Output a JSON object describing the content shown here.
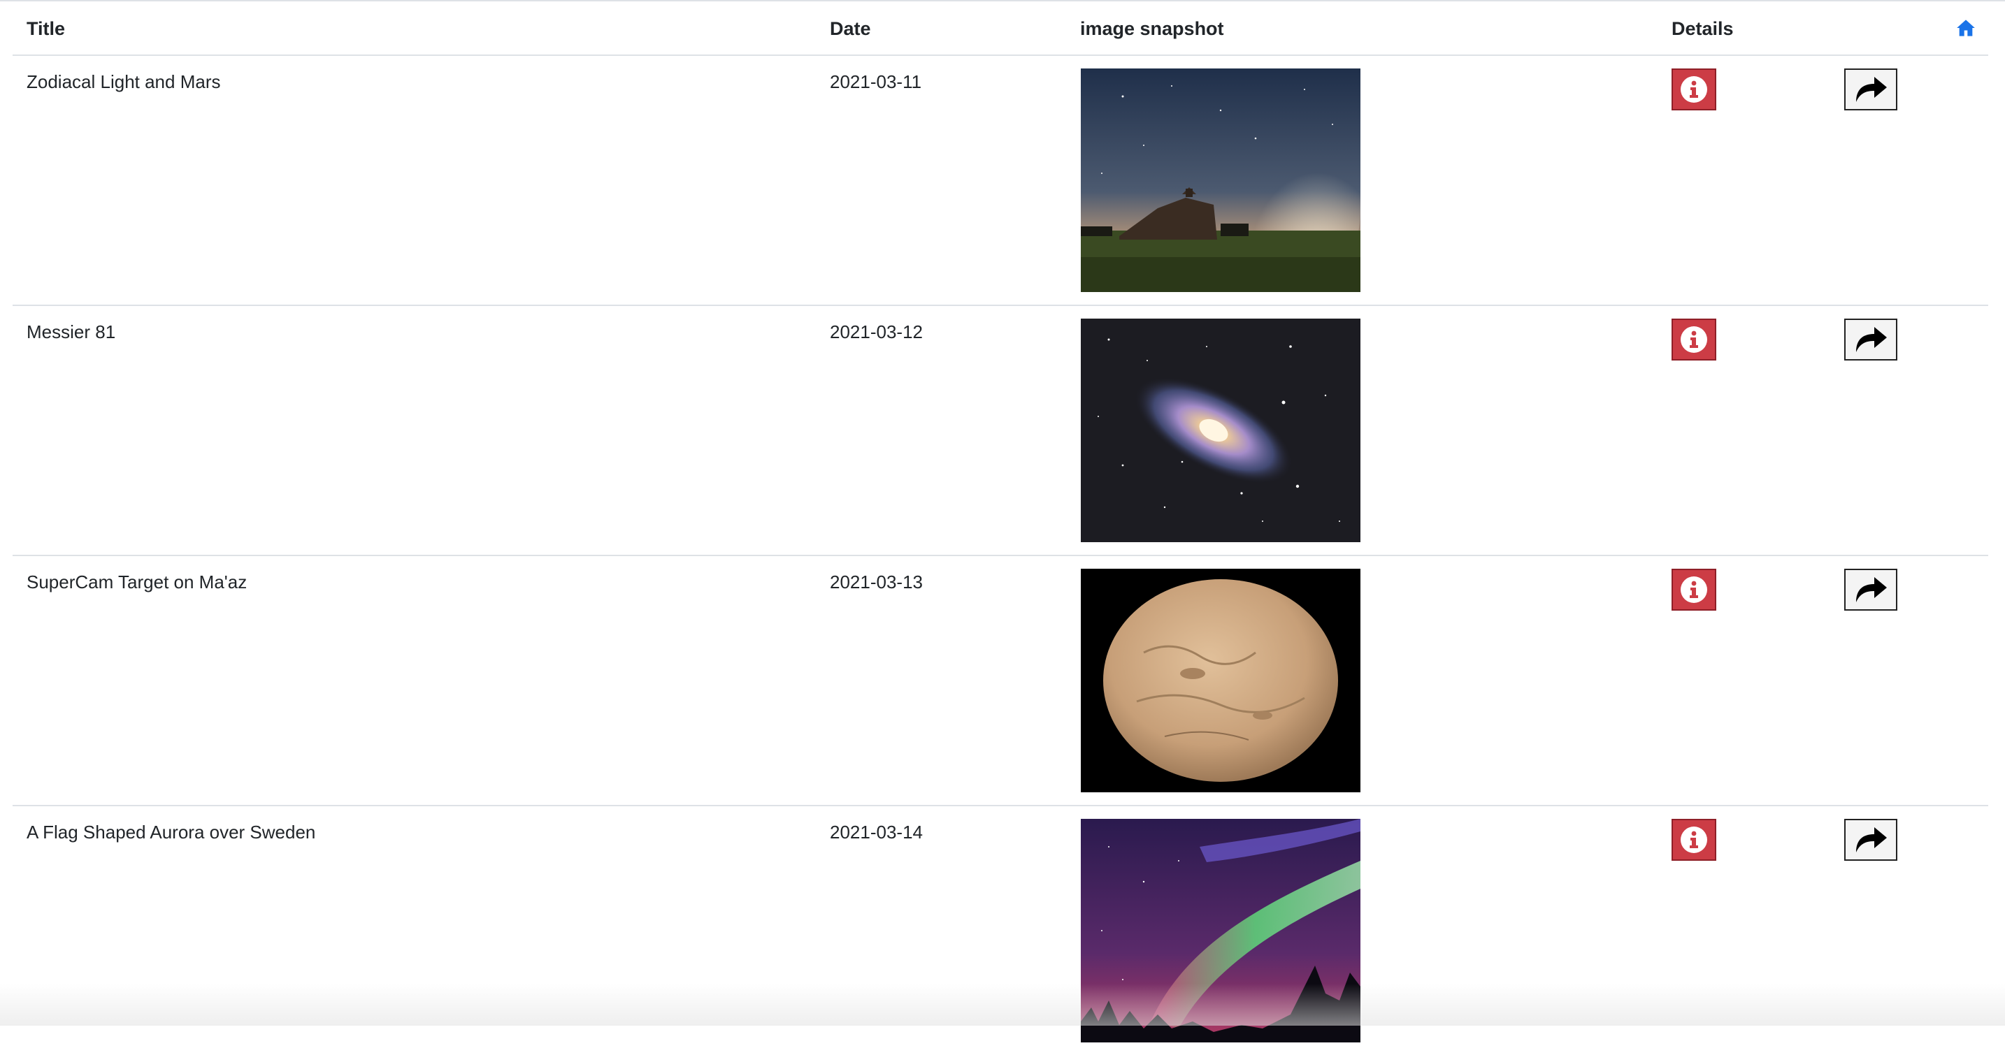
{
  "table": {
    "headers": {
      "title": "Title",
      "date": "Date",
      "snapshot": "image snapshot",
      "details": "Details"
    },
    "home_icon": "home-icon",
    "info_icon": "info-icon",
    "share_icon": "share-arrow-icon",
    "rows": [
      {
        "title": "Zodiacal Light and Mars",
        "date": "2021-03-11"
      },
      {
        "title": "Messier 81",
        "date": "2021-03-12"
      },
      {
        "title": "SuperCam Target on Ma'az",
        "date": "2021-03-13"
      },
      {
        "title": "A Flag Shaped Aurora over Sweden",
        "date": "2021-03-14"
      }
    ]
  },
  "colors": {
    "accent": "#1a73e8",
    "info_button": "#cc3c45",
    "divider": "#dee2e6"
  }
}
